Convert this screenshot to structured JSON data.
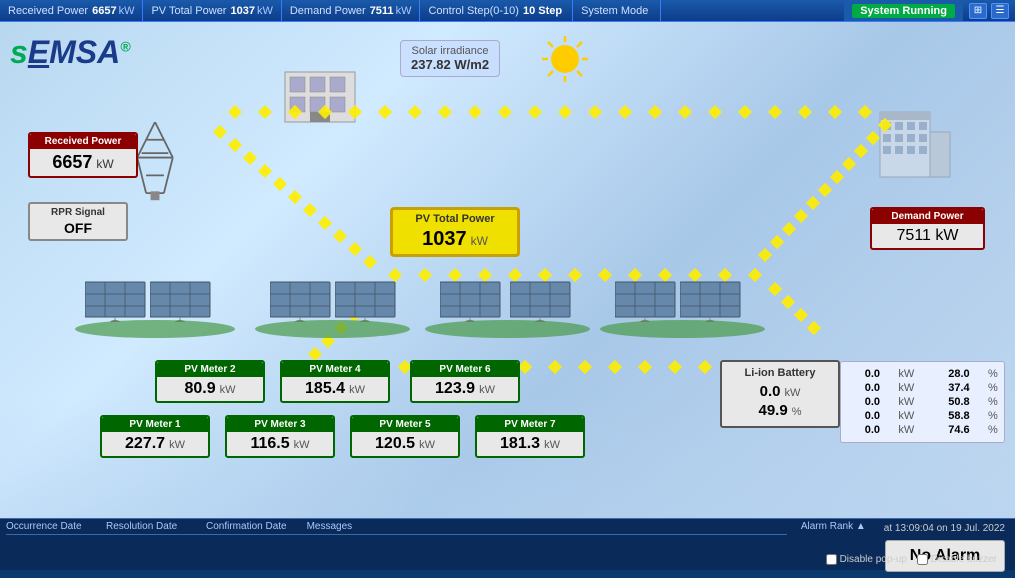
{
  "topbar": {
    "received_power_label": "Received Power",
    "received_power_value": "6657",
    "received_power_unit": "kW",
    "pv_total_power_label": "PV Total Power",
    "pv_total_power_value": "1037",
    "pv_total_power_unit": "kW",
    "demand_power_label": "Demand Power",
    "demand_power_value": "7511",
    "demand_power_unit": "kW",
    "control_step_label": "Control Step(0-10)",
    "control_step_value": "10 Step",
    "system_mode_label": "System Mode",
    "system_status": "System Running"
  },
  "logo": {
    "text": "sEMSA"
  },
  "solar_irradiance": {
    "title": "Solar irradiance",
    "value": "237.82",
    "unit": "W/m2"
  },
  "received_power": {
    "title": "Received Power",
    "value": "6657",
    "unit": "kW"
  },
  "rpr_signal": {
    "title": "RPR Signal",
    "value": "OFF"
  },
  "pv_total": {
    "title": "PV Total Power",
    "value": "1037",
    "unit": "kW"
  },
  "demand_power": {
    "title": "Demand Power",
    "value": "7511",
    "unit": "kW"
  },
  "battery": {
    "title": "Li-ion Battery",
    "row1_value": "0.0",
    "row1_unit": "kW",
    "row2_value": "49.9",
    "row2_unit": "%"
  },
  "pv_meters": [
    {
      "id": "pv1",
      "title": "PV Meter 1",
      "value": "227.7",
      "unit": "kW",
      "row": 2
    },
    {
      "id": "pv2",
      "title": "PV Meter 2",
      "value": "80.9",
      "unit": "kW",
      "row": 1
    },
    {
      "id": "pv3",
      "title": "PV Meter 3",
      "value": "116.5",
      "unit": "kW",
      "row": 2
    },
    {
      "id": "pv4",
      "title": "PV Meter 4",
      "value": "185.4",
      "unit": "kW",
      "row": 1
    },
    {
      "id": "pv5",
      "title": "PV Meter 5",
      "value": "120.5",
      "unit": "kW",
      "row": 2
    },
    {
      "id": "pv6",
      "title": "PV Meter 6",
      "value": "123.9",
      "unit": "kW",
      "row": 1
    },
    {
      "id": "pv7",
      "title": "PV Meter 7",
      "value": "181.3",
      "unit": "kW",
      "row": 2
    }
  ],
  "pct_rows": [
    {
      "kw": "0.0",
      "pct": "28.0"
    },
    {
      "kw": "0.0",
      "pct": "37.4"
    },
    {
      "kw": "0.0",
      "pct": "50.8"
    },
    {
      "kw": "0.0",
      "pct": "58.8"
    },
    {
      "kw": "0.0",
      "pct": "74.6"
    }
  ],
  "alarm_table": {
    "col1": "Occurrence Date",
    "col2": "Resolution Date",
    "col3": "Confirmation Date",
    "col4": "Messages",
    "rank_label": "Alarm Rank",
    "timestamp": "at 13:09:04 on 19 Jul. 2022",
    "no_alarm": "No Alarm",
    "disable_popup": "Disable pop-up",
    "disable_buzzer": "Disable buzzer"
  }
}
